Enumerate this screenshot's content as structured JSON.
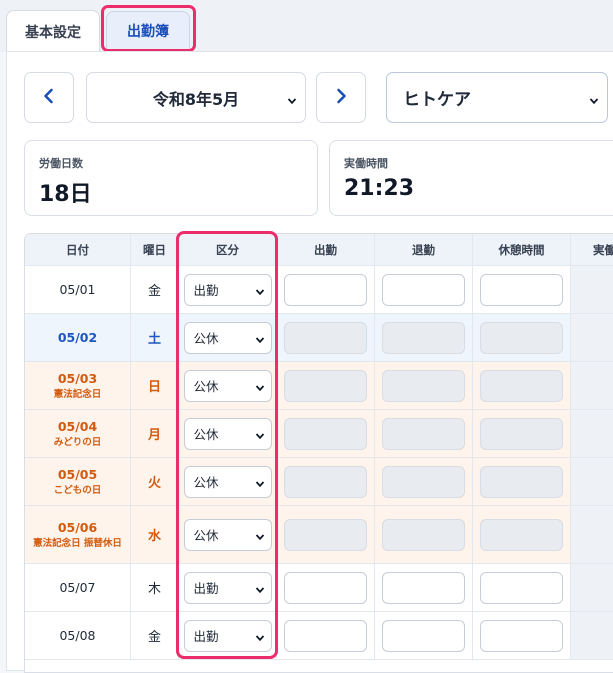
{
  "tabs": [
    {
      "label": "基本設定",
      "active": false
    },
    {
      "label": "出勤簿",
      "active": true
    }
  ],
  "toolbar": {
    "month": "令和8年5月",
    "organization": "ヒトケア"
  },
  "summary": {
    "work_days_label": "労働日数",
    "work_days_value": "18日",
    "actual_hours_label": "実働時間",
    "actual_hours_value": "21:23"
  },
  "table": {
    "headers": [
      "日付",
      "曜日",
      "区分",
      "出勤",
      "退勤",
      "休憩時間",
      "実働"
    ],
    "rows": [
      {
        "date": "05/01",
        "note": "",
        "dow": "金",
        "kubun": "出勤",
        "type": "weekday"
      },
      {
        "date": "05/02",
        "note": "",
        "dow": "土",
        "kubun": "公休",
        "type": "saturday"
      },
      {
        "date": "05/03",
        "note": "憲法記念日",
        "dow": "日",
        "kubun": "公休",
        "type": "holiday"
      },
      {
        "date": "05/04",
        "note": "みどりの日",
        "dow": "月",
        "kubun": "公休",
        "type": "holiday"
      },
      {
        "date": "05/05",
        "note": "こどもの日",
        "dow": "火",
        "kubun": "公休",
        "type": "holiday"
      },
      {
        "date": "05/06",
        "note": "憲法記念日 振替休日",
        "dow": "水",
        "kubun": "公休",
        "type": "holiday"
      },
      {
        "date": "05/07",
        "note": "",
        "dow": "木",
        "kubun": "出勤",
        "type": "weekday"
      },
      {
        "date": "05/08",
        "note": "",
        "dow": "金",
        "kubun": "出勤",
        "type": "weekday"
      }
    ]
  },
  "colors": {
    "highlight": "#ec2d6b",
    "accent": "#1d4fb8",
    "holiday_text": "#d35a0d",
    "saturday_text": "#1e56c2"
  },
  "icons": {
    "prev": "chevron-left-icon",
    "next": "chevron-right-icon",
    "dropdown": "chevron-down-icon"
  }
}
